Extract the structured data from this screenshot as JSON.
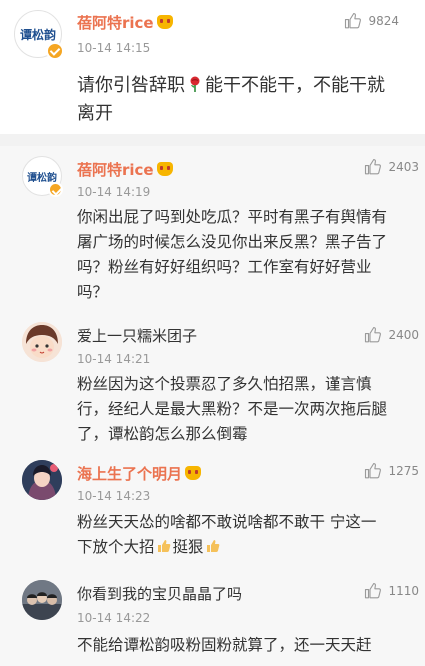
{
  "main_comment": {
    "avatar_text": "谭松韵",
    "user": "蓓阿特rice",
    "time": "10-14 14:15",
    "likes": "9824",
    "text_line1": "请你引咎辞职",
    "text_line1_after": "能干不能干，不能干就",
    "text_line2": "离开"
  },
  "replies": [
    {
      "avatar_text": "谭松韵",
      "user": "蓓阿特rice",
      "time": "10-14 14:19",
      "likes": "2403",
      "lines": [
        "你闲出屁了吗到处吃瓜？平时有黑子有舆情有",
        "屠广场的时候怎么没见你出来反黑？黑子告了",
        "吗？粉丝有好好组织吗？工作室有好好营业",
        "吗？"
      ]
    },
    {
      "user": "爱上一只糯米团子",
      "time": "10-14 14:21",
      "likes": "2400",
      "lines": [
        "粉丝因为这个投票忍了多久怕招黑，谨言慎",
        "行，经纪人是最大黑粉？不是一次两次拖后腿",
        "了，谭松韵怎么那么倒霉"
      ]
    },
    {
      "user": "海上生了个明月",
      "time": "10-14 14:23",
      "likes": "1275",
      "lines": [
        "粉丝天天怂的啥都不敢说啥都不敢干 宁这一",
        "下放个大招",
        "挺狠"
      ]
    },
    {
      "user": "你看到我的宝贝晶晶了吗",
      "time": "10-14 14:22",
      "likes": "1110",
      "lines": [
        "不能给谭松韵吸粉固粉就算了，还一天天赶"
      ]
    }
  ]
}
